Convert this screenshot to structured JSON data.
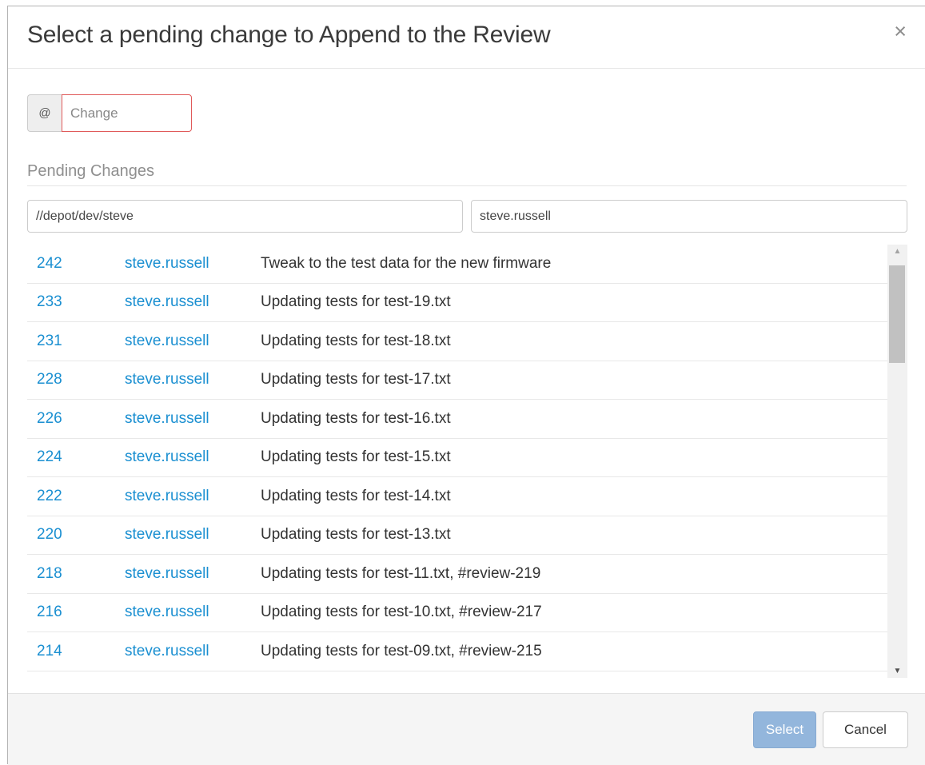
{
  "dialog": {
    "title": "Select a pending change to Append to the Review",
    "close_glyph": "×"
  },
  "change_input": {
    "addon": "@",
    "placeholder": "Change"
  },
  "section_label": "Pending Changes",
  "filters": {
    "path_value": "//depot/dev/steve",
    "user_value": "steve.russell"
  },
  "changes": [
    {
      "id": "242",
      "user": "steve.russell",
      "description": "Tweak to the test data for the new firmware"
    },
    {
      "id": "233",
      "user": "steve.russell",
      "description": "Updating tests for test-19.txt"
    },
    {
      "id": "231",
      "user": "steve.russell",
      "description": "Updating tests for test-18.txt"
    },
    {
      "id": "228",
      "user": "steve.russell",
      "description": "Updating tests for test-17.txt"
    },
    {
      "id": "226",
      "user": "steve.russell",
      "description": "Updating tests for test-16.txt"
    },
    {
      "id": "224",
      "user": "steve.russell",
      "description": "Updating tests for test-15.txt"
    },
    {
      "id": "222",
      "user": "steve.russell",
      "description": "Updating tests for test-14.txt"
    },
    {
      "id": "220",
      "user": "steve.russell",
      "description": "Updating tests for test-13.txt"
    },
    {
      "id": "218",
      "user": "steve.russell",
      "description": "Updating tests for test-11.txt, #review-219"
    },
    {
      "id": "216",
      "user": "steve.russell",
      "description": "Updating tests for test-10.txt, #review-217"
    },
    {
      "id": "214",
      "user": "steve.russell",
      "description": "Updating tests for test-09.txt, #review-215"
    }
  ],
  "footer": {
    "select_label": "Select",
    "cancel_label": "Cancel"
  },
  "colors": {
    "link": "#1a8fd1",
    "select_button": "#93b6dc",
    "invalid_border": "#e05a5a"
  }
}
